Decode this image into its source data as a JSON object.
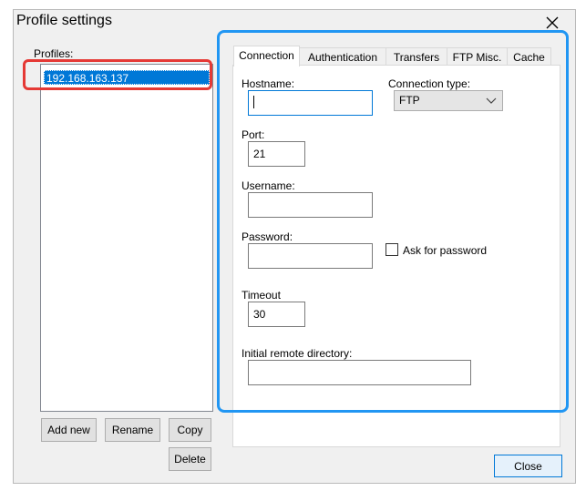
{
  "window": {
    "title": "Profile settings"
  },
  "profiles": {
    "label": "Profiles:",
    "items": [
      {
        "label": "192.168.163.137"
      }
    ]
  },
  "buttons": {
    "add_new": "Add new",
    "rename": "Rename",
    "copy": "Copy",
    "delete": "Delete",
    "close": "Close"
  },
  "tabs": [
    {
      "label": "Connection"
    },
    {
      "label": "Authentication"
    },
    {
      "label": "Transfers"
    },
    {
      "label": "FTP Misc."
    },
    {
      "label": "Cache"
    }
  ],
  "connection": {
    "hostname_label": "Hostname:",
    "hostname_value": "",
    "connection_type_label": "Connection type:",
    "connection_type_value": "FTP",
    "port_label": "Port:",
    "port_value": "21",
    "username_label": "Username:",
    "username_value": "",
    "password_label": "Password:",
    "password_value": "",
    "ask_password_label": "Ask for password",
    "ask_password_checked": false,
    "timeout_label": "Timeout",
    "timeout_value": "30",
    "initial_dir_label": "Initial remote directory:",
    "initial_dir_value": ""
  },
  "colors": {
    "selection": "#0078d7",
    "highlight_red": "#e53935",
    "highlight_blue": "#2196f3"
  },
  "icons": {
    "close": "close-icon",
    "dropdown": "chevron-down-icon"
  }
}
